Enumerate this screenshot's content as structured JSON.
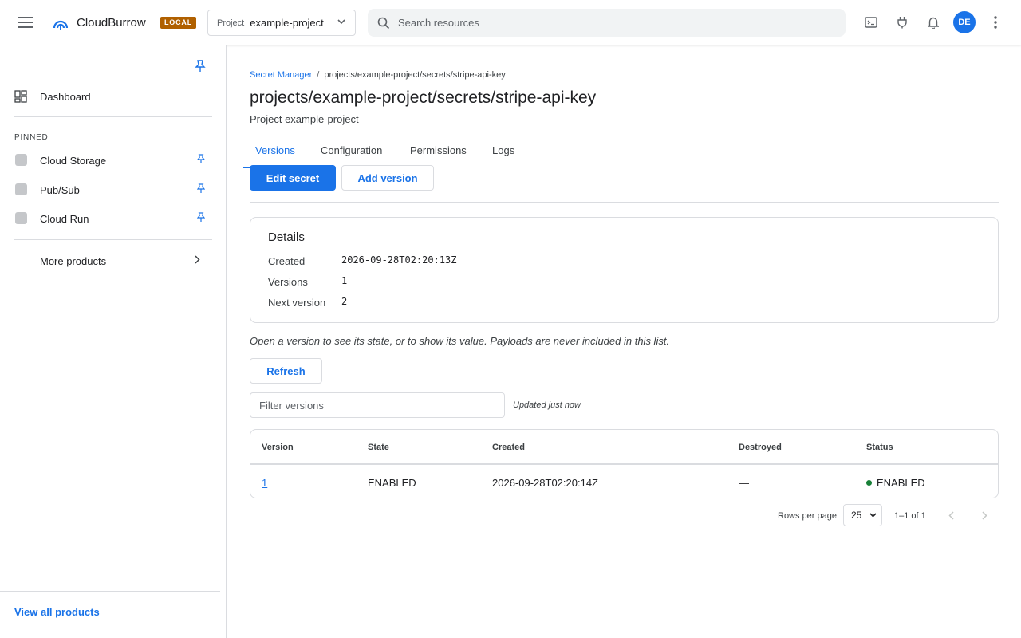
{
  "header": {
    "brand": "CloudBurrow",
    "badge": "LOCAL",
    "project_label": "Project",
    "project_value": "example-project",
    "search_placeholder": "Search resources",
    "avatar_initials": "DE",
    "icons": [
      "menu-icon",
      "cloudburrow-logo-icon",
      "chevron-down-icon",
      "search-icon",
      "terminal-icon",
      "plug-icon",
      "bell-icon",
      "more-vert-icon"
    ]
  },
  "sidebar": {
    "dashboard": "Dashboard",
    "pinned_header": "PINNED",
    "pinned": [
      {
        "label": "Cloud Storage"
      },
      {
        "label": "Pub/Sub"
      },
      {
        "label": "Cloud Run"
      }
    ],
    "more_products": "More products",
    "view_all": "View all products"
  },
  "main": {
    "breadcrumb": {
      "parent": "Secret Manager",
      "sep": "/",
      "current": "projects/example-project/secrets/stripe-api-key"
    },
    "title": "projects/example-project/secrets/stripe-api-key",
    "subtitle": "Project example-project",
    "tabs": [
      {
        "label": "Versions"
      },
      {
        "label": "Configuration"
      },
      {
        "label": "Permissions"
      },
      {
        "label": "Logs"
      }
    ],
    "active_tab": "Versions",
    "actions": {
      "edit": "Edit secret",
      "add": "Add version"
    },
    "details": {
      "title": "Details",
      "rows": [
        {
          "key": "Created",
          "value": "2026-09-28T02:20:13Z"
        },
        {
          "key": "Versions",
          "value": "1"
        },
        {
          "key": "Next version",
          "value": "2"
        }
      ]
    },
    "hint": "Open a version to see its state, or to show its value. Payloads are never included in this list.",
    "refresh": "Refresh",
    "filter_placeholder": "Filter versions",
    "updated": "Updated just now",
    "table": {
      "columns": [
        "Version",
        "State",
        "Created",
        "Destroyed",
        "Status"
      ],
      "rows": [
        {
          "version": "1",
          "state": "ENABLED",
          "created": "2026-09-28T02:20:14Z",
          "destroyed": "—",
          "status": "ENABLED"
        }
      ]
    },
    "pagination": {
      "rows_label": "Rows per page",
      "rows_value": "25",
      "range": "1–1 of 1"
    }
  },
  "colors": {
    "accent": "#1a73e8",
    "badge": "#b06000",
    "status_enabled": "#188038"
  }
}
